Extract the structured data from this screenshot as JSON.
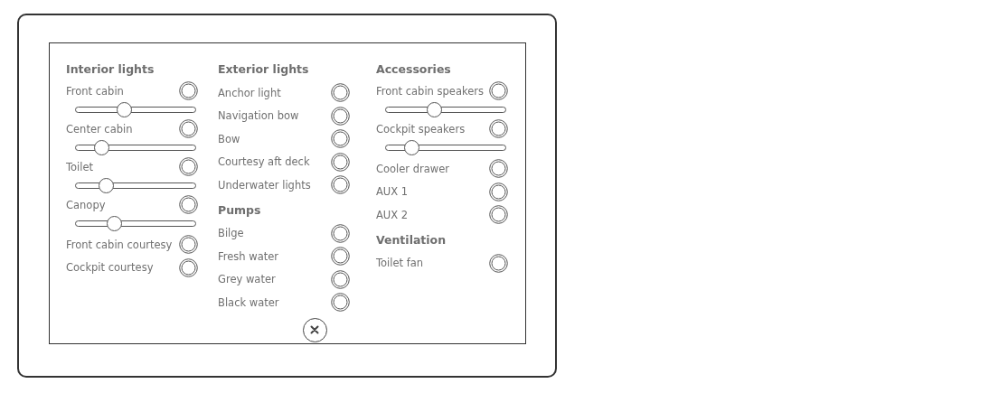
{
  "columns": [
    {
      "sections": [
        {
          "title": "Interior lights",
          "items": [
            {
              "label": "Front cabin",
              "kind": "dimmer",
              "on": false,
              "level": 0.4
            },
            {
              "label": "Center cabin",
              "kind": "dimmer",
              "on": false,
              "level": 0.22
            },
            {
              "label": "Toilet",
              "kind": "dimmer",
              "on": false,
              "level": 0.25
            },
            {
              "label": "Canopy",
              "kind": "dimmer",
              "on": false,
              "level": 0.32
            },
            {
              "label": "Front cabin courtesy",
              "kind": "toggle",
              "on": false
            },
            {
              "label": "Cockpit courtesy",
              "kind": "toggle",
              "on": false
            }
          ]
        }
      ]
    },
    {
      "sections": [
        {
          "title": "Exterior lights",
          "items": [
            {
              "label": "Anchor light",
              "kind": "toggle",
              "on": false
            },
            {
              "label": "Navigation bow",
              "kind": "toggle",
              "on": false
            },
            {
              "label": "Bow",
              "kind": "toggle",
              "on": false
            },
            {
              "label": "Courtesy aft deck",
              "kind": "toggle",
              "on": false
            },
            {
              "label": "Underwater lights",
              "kind": "toggle",
              "on": false
            }
          ]
        },
        {
          "title": "Pumps",
          "items": [
            {
              "label": "Bilge",
              "kind": "toggle",
              "on": false
            },
            {
              "label": "Fresh water",
              "kind": "toggle",
              "on": false
            },
            {
              "label": "Grey water",
              "kind": "toggle",
              "on": false
            },
            {
              "label": "Black water",
              "kind": "toggle",
              "on": false
            }
          ]
        }
      ],
      "close": true
    },
    {
      "sections": [
        {
          "title": "Accessories",
          "items": [
            {
              "label": "Front cabin speakers",
              "kind": "dimmer",
              "on": false,
              "level": 0.4
            },
            {
              "label": "Cockpit speakers",
              "kind": "dimmer",
              "on": false,
              "level": 0.22
            },
            {
              "label": "Cooler drawer",
              "kind": "toggle",
              "on": false
            },
            {
              "label": "AUX 1",
              "kind": "toggle",
              "on": false
            },
            {
              "label": "AUX 2",
              "kind": "toggle",
              "on": false
            }
          ]
        },
        {
          "title": "Ventilation",
          "items": [
            {
              "label": "Toilet fan",
              "kind": "toggle",
              "on": false
            }
          ]
        }
      ]
    }
  ]
}
